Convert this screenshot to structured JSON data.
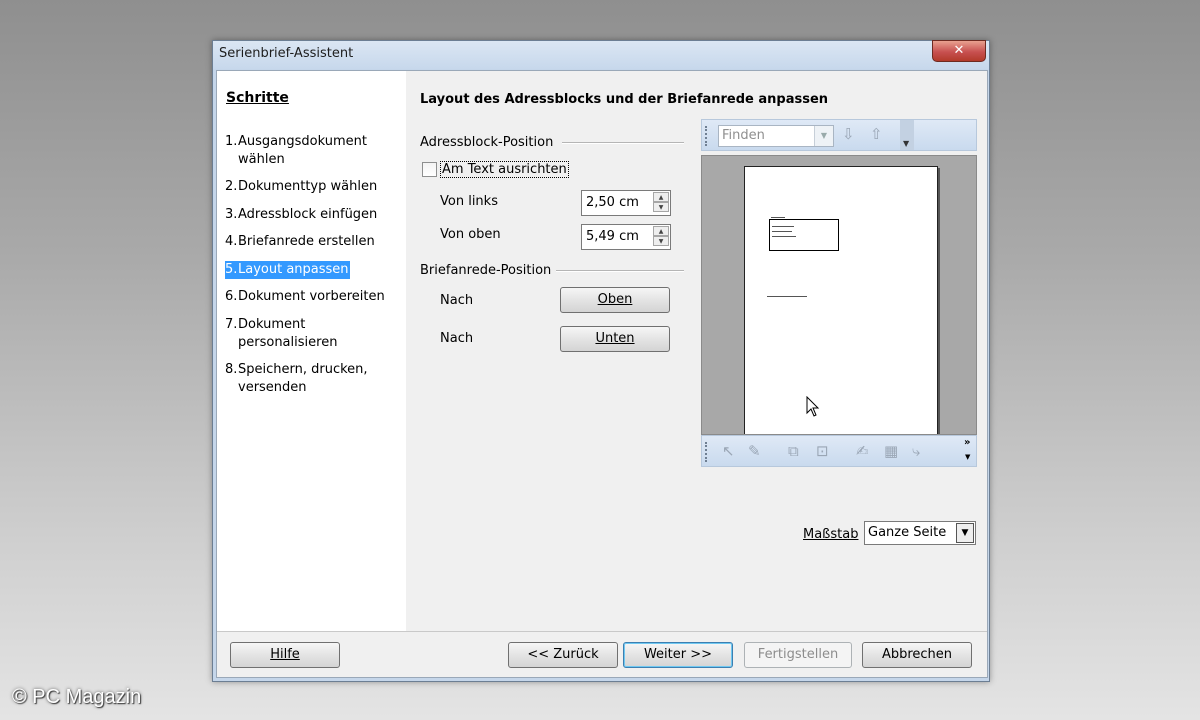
{
  "window": {
    "title": "Serienbrief-Assistent"
  },
  "steps": {
    "title": "Schritte",
    "items": [
      {
        "num": "1.",
        "label": "Ausgangsdokument wählen"
      },
      {
        "num": "2.",
        "label": "Dokumenttyp wählen"
      },
      {
        "num": "3.",
        "label": "Adressblock einfügen"
      },
      {
        "num": "4.",
        "label": "Briefanrede erstellen"
      },
      {
        "num": "5.",
        "label": "Layout anpassen",
        "active": true
      },
      {
        "num": "6.",
        "label": "Dokument vorbereiten"
      },
      {
        "num": "7.",
        "label": "Dokument personalisieren"
      },
      {
        "num": "8.",
        "label": "Speichern, drucken, versenden"
      }
    ]
  },
  "main": {
    "heading": "Layout des Adressblocks und der Briefanrede anpassen",
    "address_section": "Adressblock-Position",
    "align_checkbox": "Am Text ausrichten",
    "align_checked": false,
    "from_left_label": "Von links",
    "from_left_value": "2,50 cm",
    "from_top_label": "Von oben",
    "from_top_value": "5,49 cm",
    "salutation_section": "Briefanrede-Position",
    "move_label_1": "Nach",
    "move_button_1": "Oben",
    "move_label_2": "Nach",
    "move_button_2": "Unten"
  },
  "preview": {
    "find_placeholder": "Finden",
    "scale_label": "Maßstab",
    "scale_value": "Ganze Seite"
  },
  "buttons": {
    "help": "Hilfe",
    "back": "<< Zurück",
    "next": "Weiter >>",
    "finish": "Fertigstellen",
    "cancel": "Abbrechen"
  },
  "watermark": "© PC Magazin",
  "colors": {
    "selection": "#3399ff",
    "titlebar": "#c7d8ec",
    "close": "#c75050"
  },
  "icons": [
    "close-icon",
    "arrow-down-icon",
    "arrow-up-icon",
    "pointer-icon"
  ]
}
